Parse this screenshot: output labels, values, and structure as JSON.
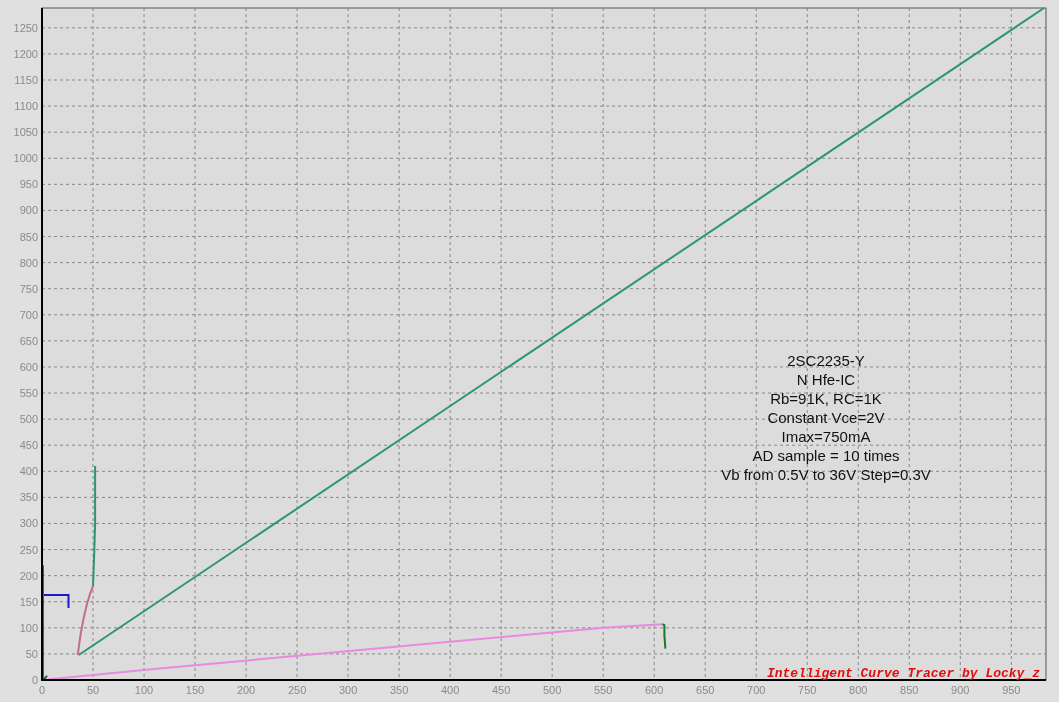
{
  "chart_data": {
    "type": "line",
    "grid": true,
    "xlim": [
      0,
      984
    ],
    "ylim": [
      0,
      1288
    ],
    "xticks": [
      0,
      50,
      100,
      150,
      200,
      250,
      300,
      350,
      400,
      450,
      500,
      550,
      600,
      650,
      700,
      750,
      800,
      850,
      900,
      950
    ],
    "yticks": [
      0,
      50,
      100,
      150,
      200,
      250,
      300,
      350,
      400,
      450,
      500,
      550,
      600,
      650,
      700,
      750,
      800,
      850,
      900,
      950,
      1000,
      1050,
      1100,
      1150,
      1200,
      1250
    ],
    "series": [
      {
        "color": "#2e9479",
        "x": [
          36,
          982
        ],
        "values": [
          48,
          1288
        ]
      },
      {
        "color": "#2e9479",
        "x": [
          50,
          51,
          52,
          52
        ],
        "values": [
          180,
          230,
          300,
          410
        ]
      },
      {
        "color": "#c07080",
        "x": [
          35,
          38,
          41,
          44,
          47,
          50
        ],
        "values": [
          48,
          90,
          120,
          145,
          165,
          180
        ]
      },
      {
        "color": "#e88ae0",
        "x": [
          0,
          115,
          550,
          608
        ],
        "values": [
          0,
          22,
          100,
          107
        ]
      },
      {
        "color": "#1a7a2a",
        "x": [
          608,
          610,
          610,
          611
        ],
        "values": [
          107,
          105,
          85,
          60
        ]
      },
      {
        "color": "#1a7a2a",
        "x": [
          0,
          3,
          5
        ],
        "values": [
          0,
          4,
          8
        ]
      },
      {
        "color": "#1a1acc",
        "x": [
          0,
          26,
          26
        ],
        "values": [
          163,
          163,
          138
        ]
      },
      {
        "color": "#e02020",
        "x": [
          1,
          1
        ],
        "values": [
          0,
          220
        ]
      }
    ],
    "annotations": [
      "2SC2235-Y",
      "N Hfe-IC",
      "Rb=91K, RC=1K",
      "Constant Vce=2V",
      "Imax=750mA",
      "AD sample = 10 times",
      "Vb from 0.5V to 36V Step=0.3V"
    ]
  },
  "credit": "Intelligent Curve Tracer by Locky_z"
}
